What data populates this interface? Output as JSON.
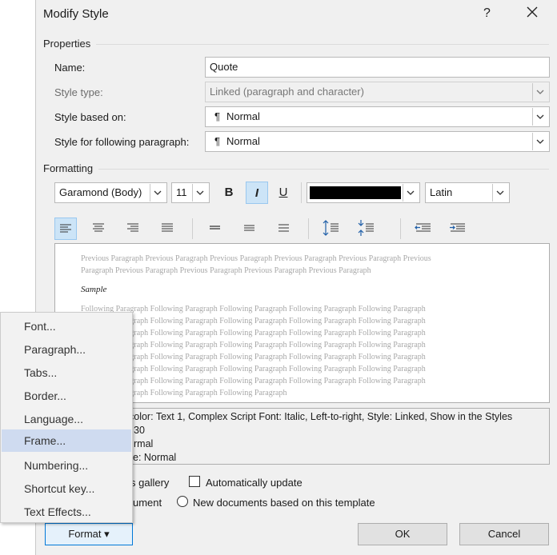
{
  "dialog": {
    "title": "Modify Style",
    "help_glyph": "?",
    "close_glyph": "✕"
  },
  "properties": {
    "section_label": "Properties",
    "name_label": "Name:",
    "name_value": "Quote",
    "style_type_label": "Style type:",
    "style_type_value": "Linked (paragraph and character)",
    "based_on_label": "Style based on:",
    "based_on_value": "Normal",
    "following_label": "Style for following paragraph:",
    "following_value": "Normal",
    "pilcrow": "¶"
  },
  "formatting": {
    "section_label": "Formatting",
    "font_name": "Garamond (Body)",
    "font_size": "11",
    "bold_label": "B",
    "italic_label": "I",
    "underline_label": "U",
    "font_color": "#000000",
    "script_value": "Latin"
  },
  "toolbar_icons": [
    "align-left-icon",
    "align-center-icon",
    "align-right-icon",
    "justify-icon",
    "single-spacing-icon",
    "one-half-spacing-icon",
    "double-spacing-icon",
    "increase-paragraph-spacing-icon",
    "decrease-paragraph-spacing-icon",
    "decrease-indent-icon",
    "increase-indent-icon"
  ],
  "preview": {
    "previous_lines": [
      "Previous Paragraph Previous Paragraph Previous Paragraph Previous Paragraph Previous Paragraph Previous",
      "Paragraph Previous Paragraph Previous Paragraph Previous Paragraph Previous Paragraph"
    ],
    "sample_text": "Sample",
    "following_lines": [
      "Following Paragraph Following Paragraph Following Paragraph Following Paragraph Following Paragraph",
      "Following Paragraph Following Paragraph Following Paragraph Following Paragraph Following Paragraph",
      "Following Paragraph Following Paragraph Following Paragraph Following Paragraph Following Paragraph",
      "Following Paragraph Following Paragraph Following Paragraph Following Paragraph Following Paragraph",
      "Following Paragraph Following Paragraph Following Paragraph Following Paragraph Following Paragraph",
      "Following Paragraph Following Paragraph Following Paragraph Following Paragraph Following Paragraph",
      "Following Paragraph Following Paragraph Following Paragraph Following Paragraph Following Paragraph",
      "Following Paragraph Following Paragraph Following Paragraph"
    ]
  },
  "description": {
    "lines": [
      "color: Text 1, Complex Script Font: Italic, Left-to-right, Style: Linked, Show in the Styles",
      "30",
      "rmal",
      "e: Normal"
    ]
  },
  "options": {
    "gallery_label": "s gallery",
    "auto_update_label": "Automatically update",
    "document_label": "ument",
    "template_label": "New documents based on this template"
  },
  "buttons": {
    "format_label": "Format",
    "format_arrow": "▾",
    "ok_label": "OK",
    "cancel_label": "Cancel"
  },
  "format_menu": {
    "items": [
      "Font...",
      "Paragraph...",
      "Tabs...",
      "Border...",
      "Language...",
      "Frame...",
      "Numbering...",
      "Shortcut key...",
      "Text Effects..."
    ],
    "highlighted": "Frame..."
  }
}
